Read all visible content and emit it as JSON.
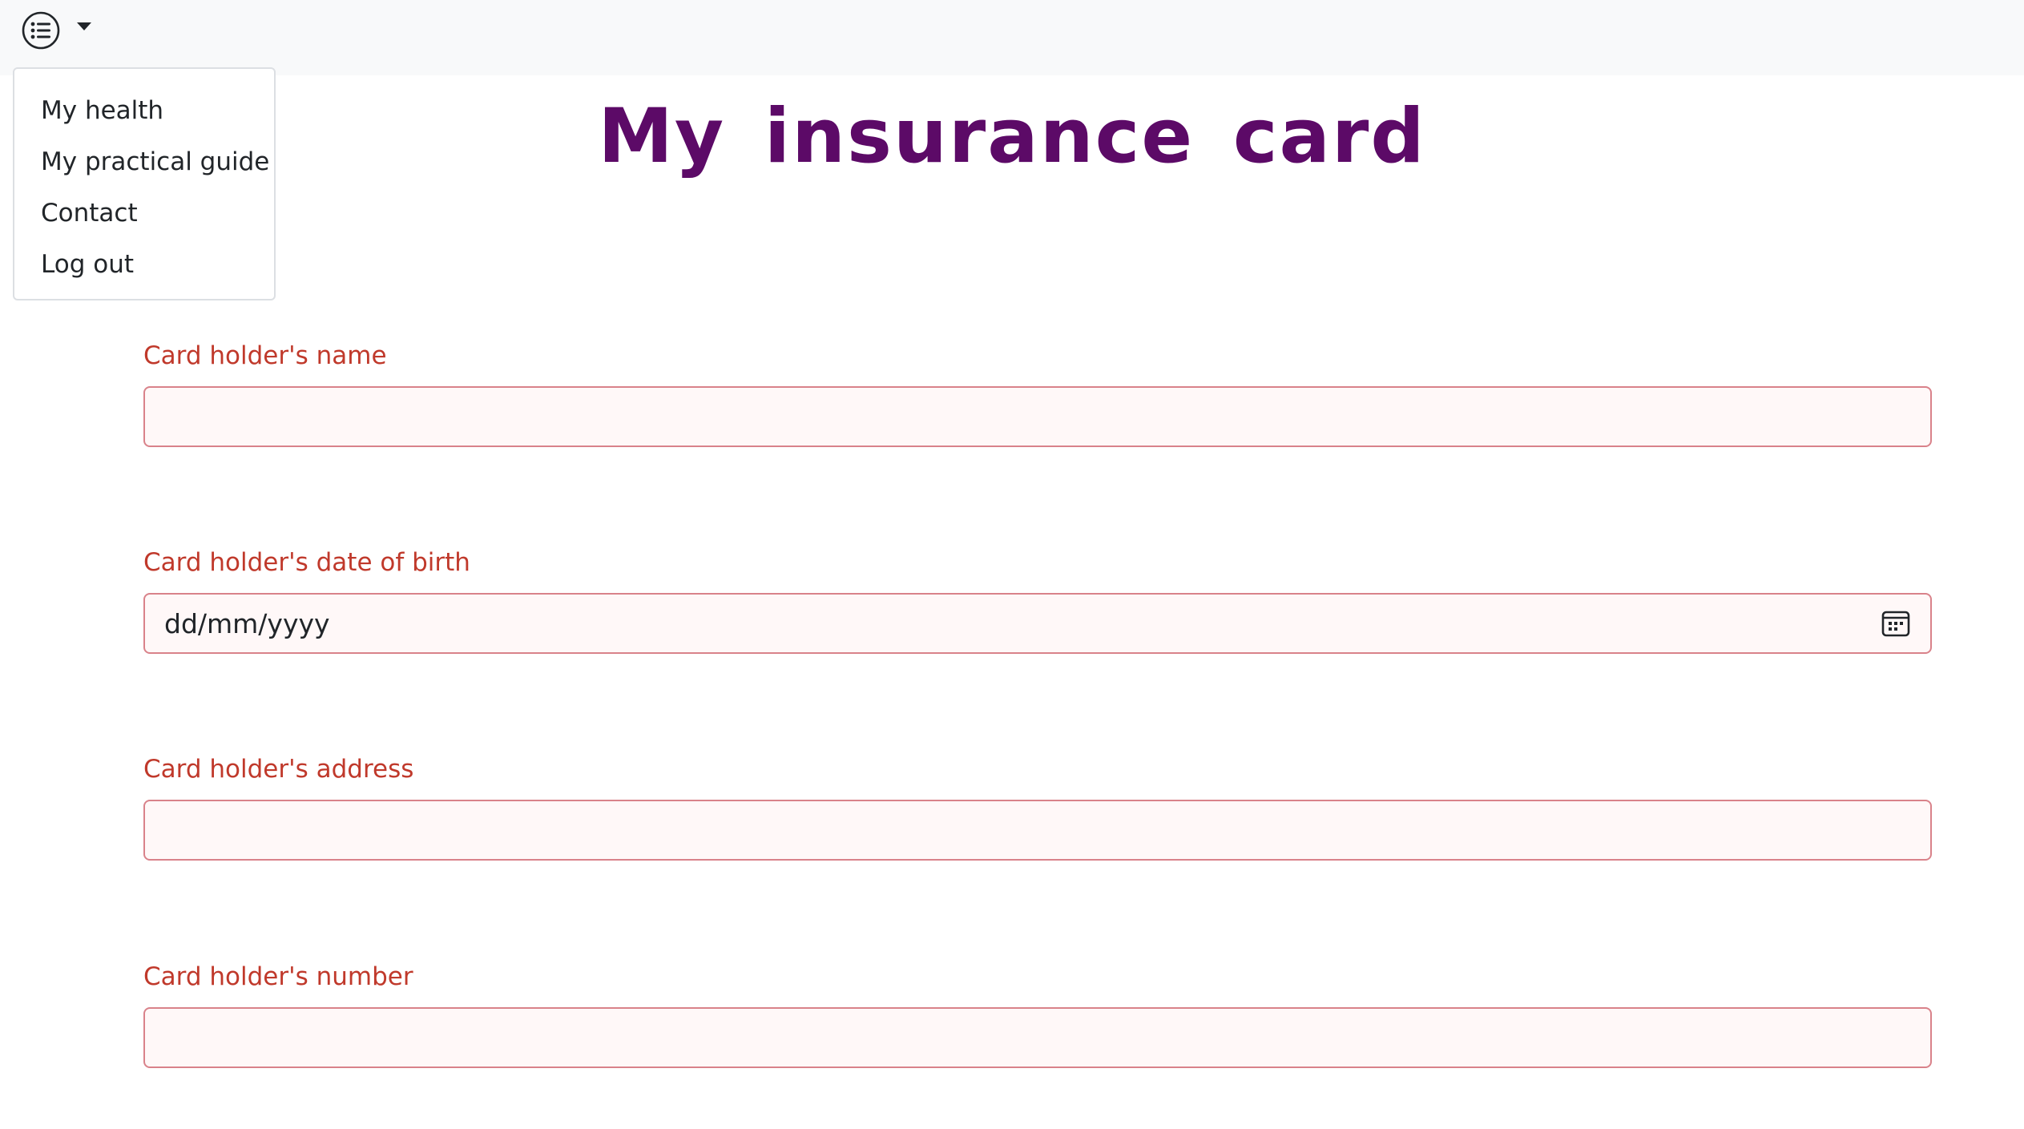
{
  "navbar": {
    "menu_icon": "list-circle-icon",
    "caret_icon": "caret-down-icon"
  },
  "dropdown": {
    "items": [
      {
        "label": "My health"
      },
      {
        "label": "My practical guide"
      },
      {
        "label": "Contact"
      },
      {
        "label": "Log out"
      }
    ]
  },
  "page": {
    "title": "My insurance card",
    "title_color": "#5c0a67"
  },
  "form": {
    "label_color": "#c0392b",
    "invalid_border_color": "#d9828a",
    "fields": [
      {
        "label": "Card holder's name",
        "value": "",
        "placeholder": ""
      },
      {
        "label": "Card holder's date of birth",
        "value": "",
        "placeholder": "dd/mm/yyyy",
        "icon": "calendar-icon"
      },
      {
        "label": "Card holder's address",
        "value": "",
        "placeholder": ""
      },
      {
        "label": "Card holder's number",
        "value": "",
        "placeholder": ""
      }
    ]
  }
}
